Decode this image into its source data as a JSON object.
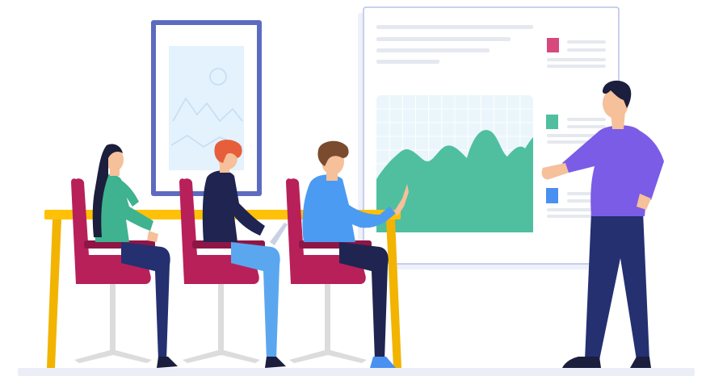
{
  "scene": {
    "kind": "illustration",
    "subject": "team-meeting-presentation"
  },
  "colors": {
    "frame": "#5C6BC0",
    "picture_fill": "#E3F2FD",
    "board_border": "#B8C0E8",
    "board_fill": "#FFFFFF",
    "board_shadow": "#EEF0FA",
    "text_lines": "#E6E8EF",
    "chart_grid_bg": "#EAF6FB",
    "chart_grid_line": "#FFFFFF",
    "chart_area": "#4FBF9F",
    "legend_pink": "#D6487E",
    "legend_teal": "#4FBF9F",
    "legend_blue": "#4A90F0",
    "table": "#FFC107",
    "table_leg": "#F2B400",
    "chair": "#B8205A",
    "chair_dark": "#8E1646",
    "chair_stem": "#DCDCDC",
    "floor": "#ECEEF7",
    "skin": "#F5C09A",
    "hair_dark": "#1B1E3C",
    "hair_red": "#E65F3A",
    "hair_brown": "#7A4B2E",
    "shirt_green": "#3FB28F",
    "shirt_navy": "#1F2550",
    "shirt_blue": "#4C9BF2",
    "shirt_purple": "#7A5CE6",
    "pants_navy": "#243070",
    "pants_lightblue": "#5AA7F0",
    "pants_dark": "#1F2550",
    "shoe": "#1B1E3C",
    "laptop": "#C9D2E3"
  },
  "icons": {
    "picture": "landscape-picture-icon"
  }
}
